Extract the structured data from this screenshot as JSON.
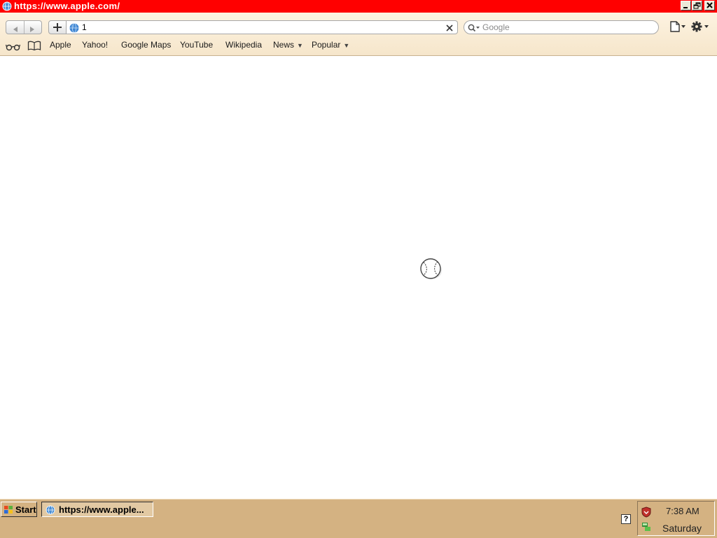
{
  "window": {
    "title": "https://www.apple.com/"
  },
  "toolbar": {
    "url_value": "1",
    "search_placeholder": "Google"
  },
  "bookmarks": [
    {
      "label": "Apple"
    },
    {
      "label": "Yahoo!"
    },
    {
      "label": "Google Maps"
    },
    {
      "label": "YouTube"
    },
    {
      "label": "Wikipedia"
    },
    {
      "label": "News",
      "dropdown": true
    },
    {
      "label": "Popular",
      "dropdown": true
    }
  ],
  "taskbar": {
    "start_label": "Start",
    "task_label": "https://www.apple...",
    "clock": "7:38 AM",
    "day": "Saturday"
  },
  "colors": {
    "titlebar": "#ff0000",
    "taskbar": "#d4b282",
    "toolbar": "#f6e6cb"
  },
  "icons": [
    "globe-icon",
    "back-arrow-icon",
    "forward-arrow-icon",
    "plus-icon",
    "clear-icon",
    "search-icon",
    "page-icon",
    "gear-icon",
    "reading-list-icon",
    "bookmarks-book-icon",
    "loading-spinner-icon",
    "windows-logo-icon",
    "help-icon",
    "shield-icon",
    "network-icon"
  ]
}
